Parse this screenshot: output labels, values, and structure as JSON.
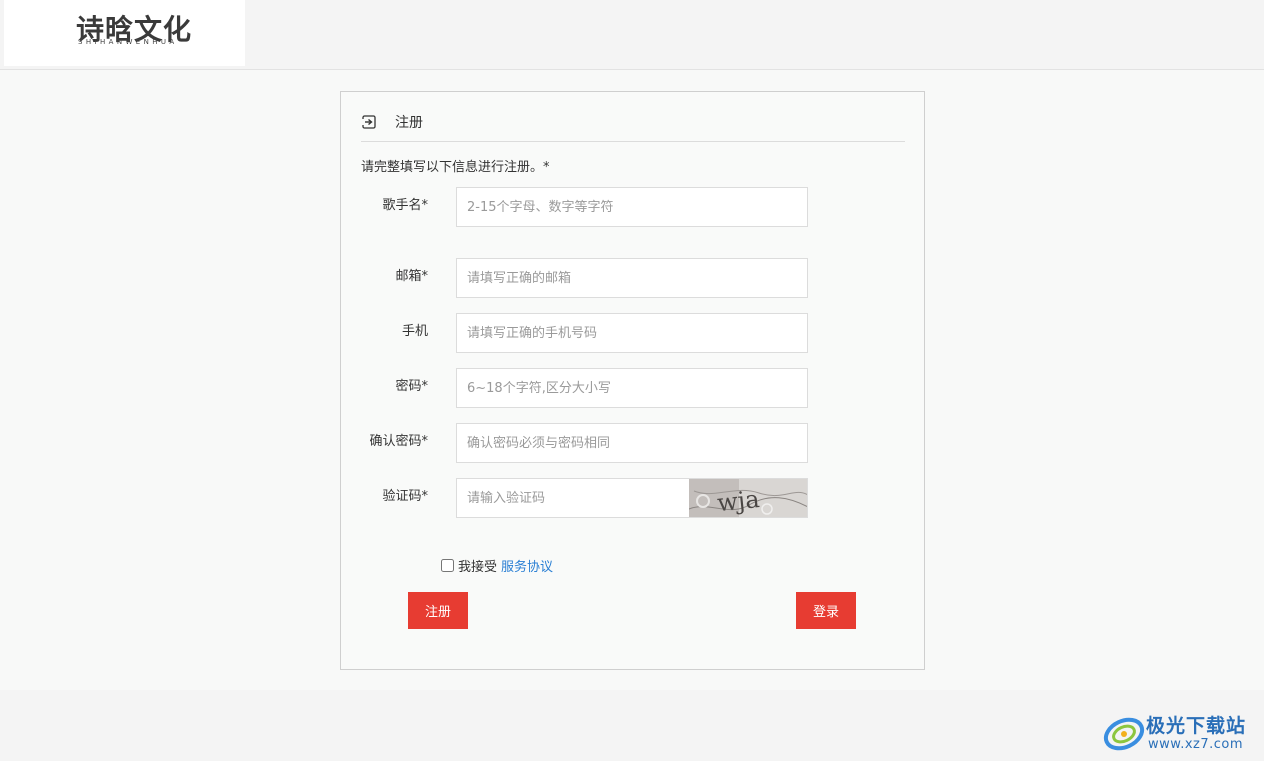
{
  "header": {
    "logo_text": "诗晗文化",
    "logo_subtext": "SHIHANWENHUA"
  },
  "panel": {
    "title": "注册",
    "intro": "请完整填写以下信息进行注册。*",
    "fields": [
      {
        "label": "歌手名*",
        "placeholder": "2-15个字母、数字等字符",
        "value": ""
      },
      {
        "label": "邮箱*",
        "placeholder": "请填写正确的邮箱",
        "value": ""
      },
      {
        "label": "手机",
        "placeholder": "请填写正确的手机号码",
        "value": ""
      },
      {
        "label": "密码*",
        "placeholder": "6~18个字符,区分大小写",
        "value": ""
      },
      {
        "label": "确认密码*",
        "placeholder": "确认密码必须与密码相同",
        "value": ""
      },
      {
        "label": "验证码*",
        "placeholder": "请输入验证码",
        "value": ""
      }
    ],
    "captcha_text": "wja",
    "agree_text": "我接受",
    "agree_link": "服务协议",
    "agree_checked": false,
    "register_button": "注册",
    "login_button": "登录"
  },
  "watermark": {
    "name": "极光下载站",
    "url": "www.xz7.com"
  },
  "colors": {
    "accent": "#e73c32",
    "link": "#2a7fd4"
  }
}
